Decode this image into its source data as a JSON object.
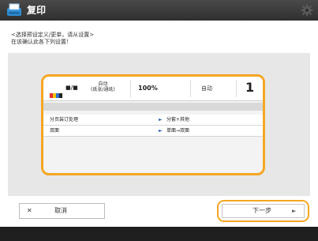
{
  "app": {
    "title": "复印"
  },
  "message": {
    "line1": "<选择预设定义/更单，请从设置>",
    "line2": "在该确认此各下列设置！"
  },
  "summary": {
    "color_mode": "■/■",
    "paper_size_line1": "自动",
    "paper_size_line2": "(纸张/通纸)",
    "zoom": "100%",
    "density": "自动",
    "copies": "1"
  },
  "settings_rows": [
    {
      "label": "分页装订处理",
      "value": "分套+其他"
    },
    {
      "label": "双面",
      "value": "单面→双面"
    }
  ],
  "buttons": {
    "cancel_label": "取消",
    "next_label": "下一步"
  },
  "colors": {
    "accent": "#f5a623",
    "titlebar": "#3a3a3a",
    "panel": "#e7e7e7"
  }
}
